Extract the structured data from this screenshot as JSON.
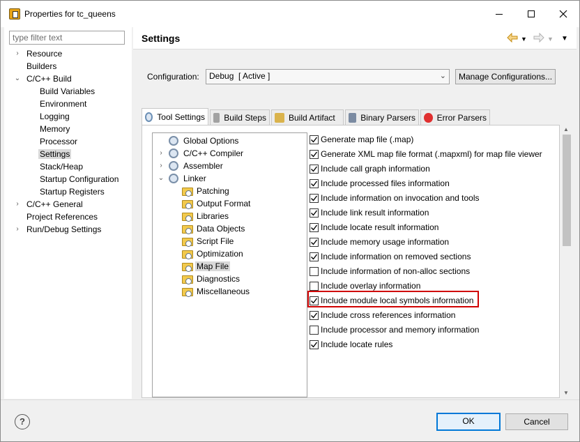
{
  "window": {
    "title": "Properties for tc_queens",
    "icon": "eclipse-properties-icon"
  },
  "filter": {
    "placeholder": "type filter text",
    "value": ""
  },
  "nav": [
    {
      "label": "Resource",
      "expander": "collapsed"
    },
    {
      "label": "Builders",
      "expander": "none"
    },
    {
      "label": "C/C++ Build",
      "expander": "expanded"
    },
    {
      "label": "Build Variables",
      "expander": "none"
    },
    {
      "label": "Environment",
      "expander": "none"
    },
    {
      "label": "Logging",
      "expander": "none"
    },
    {
      "label": "Memory",
      "expander": "none"
    },
    {
      "label": "Processor",
      "expander": "none"
    },
    {
      "label": "Settings",
      "expander": "none",
      "selected": true
    },
    {
      "label": "Stack/Heap",
      "expander": "none"
    },
    {
      "label": "Startup Configuration",
      "expander": "none"
    },
    {
      "label": "Startup Registers",
      "expander": "none"
    },
    {
      "label": "C/C++ General",
      "expander": "collapsed"
    },
    {
      "label": "Project References",
      "expander": "none"
    },
    {
      "label": "Run/Debug Settings",
      "expander": "collapsed"
    }
  ],
  "header": {
    "title": "Settings",
    "back_icon": "back-arrow-icon",
    "forward_icon": "forward-arrow-icon",
    "menu_icon": "view-menu-icon"
  },
  "configuration": {
    "label": "Configuration:",
    "value": "Debug  [ Active ]",
    "manage_label": "Manage Configurations..."
  },
  "tabs": [
    {
      "label": "Tool Settings",
      "icon": "gear-icon",
      "active": true
    },
    {
      "label": "Build Steps",
      "icon": "build-steps-icon"
    },
    {
      "label": "Build Artifact",
      "icon": "trophy-icon"
    },
    {
      "label": "Binary Parsers",
      "icon": "binary-file-icon"
    },
    {
      "label": "Error Parsers",
      "icon": "error-icon"
    }
  ],
  "tool_tree": [
    {
      "label": "Global Options",
      "type": "gear",
      "expander": "none"
    },
    {
      "label": "C/C++ Compiler",
      "type": "gear",
      "expander": "collapsed"
    },
    {
      "label": "Assembler",
      "type": "gear",
      "expander": "collapsed"
    },
    {
      "label": "Linker",
      "type": "gear",
      "expander": "expanded"
    },
    {
      "label": "Patching",
      "type": "folder",
      "expander": "none"
    },
    {
      "label": "Output Format",
      "type": "folder",
      "expander": "none"
    },
    {
      "label": "Libraries",
      "type": "folder",
      "expander": "none"
    },
    {
      "label": "Data Objects",
      "type": "folder",
      "expander": "none"
    },
    {
      "label": "Script File",
      "type": "folder",
      "expander": "none"
    },
    {
      "label": "Optimization",
      "type": "folder",
      "expander": "none"
    },
    {
      "label": "Map File",
      "type": "folder",
      "expander": "none",
      "selected": true
    },
    {
      "label": "Diagnostics",
      "type": "folder",
      "expander": "none"
    },
    {
      "label": "Miscellaneous",
      "type": "folder",
      "expander": "none"
    }
  ],
  "options": [
    {
      "label": "Generate map file (.map)",
      "checked": true
    },
    {
      "label": "Generate XML map file format (.mapxml) for map file viewer",
      "checked": true
    },
    {
      "label": "Include call graph information",
      "checked": true
    },
    {
      "label": "Include processed files information",
      "checked": true
    },
    {
      "label": "Include information on invocation and tools",
      "checked": true
    },
    {
      "label": "Include link result information",
      "checked": true
    },
    {
      "label": "Include locate result information",
      "checked": true
    },
    {
      "label": "Include memory usage information",
      "checked": true
    },
    {
      "label": "Include information on removed sections",
      "checked": true
    },
    {
      "label": "Include information of non-alloc sections",
      "checked": false
    },
    {
      "label": "Include overlay information",
      "checked": false
    },
    {
      "label": "Include module local symbols information",
      "checked": true,
      "highlighted": true
    },
    {
      "label": "Include cross references information",
      "checked": true
    },
    {
      "label": "Include processor and memory information",
      "checked": false
    },
    {
      "label": "Include locate rules",
      "checked": true
    }
  ],
  "footer": {
    "help_icon": "help-icon",
    "help_glyph": "?",
    "ok_label": "OK",
    "cancel_label": "Cancel"
  },
  "colors": {
    "highlight": "#d00000",
    "selection": "#d9d9d9",
    "ok_border": "#0078d7"
  }
}
